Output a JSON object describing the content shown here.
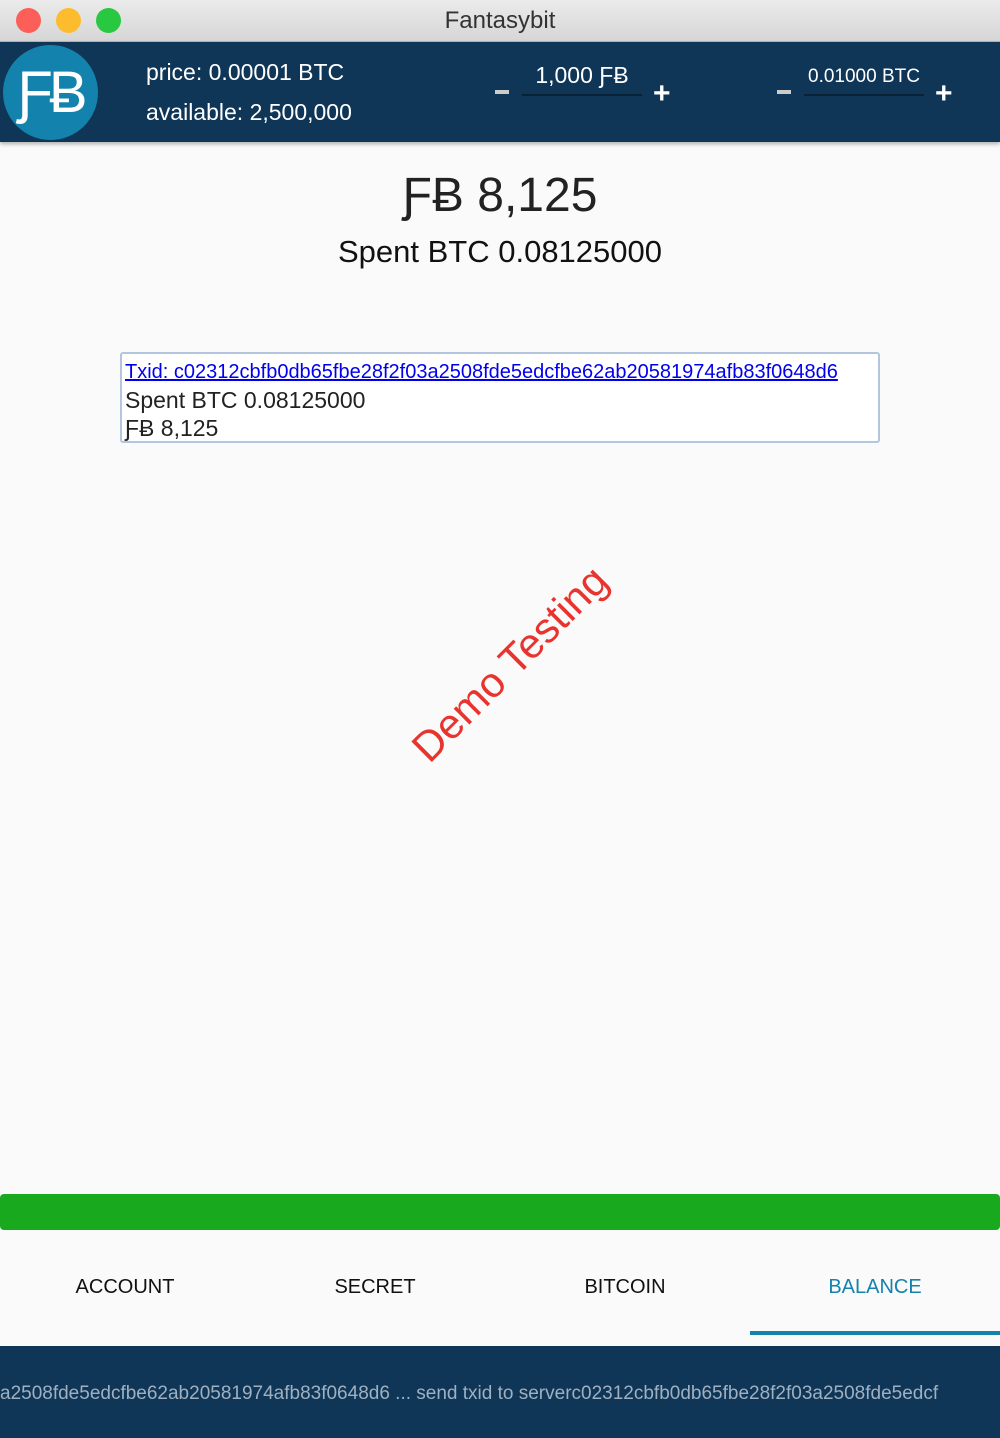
{
  "window": {
    "title": "Fantasybit"
  },
  "header": {
    "logo_text": "ƑɃ",
    "price": "price: 0.00001 BTC",
    "available": "available: 2,500,000",
    "fb_amount": "1,000 ƑɃ",
    "btc_amount": "0.01000 BTC"
  },
  "main": {
    "fb_total": "ƑɃ 8,125",
    "spent": "Spent BTC 0.08125000"
  },
  "receipt": {
    "txid": "Txid: c02312cbfb0db65fbe28f2f03a2508fde5edcfbe62ab20581974afb83f0648d6",
    "spent": "Spent BTC 0.08125000",
    "fb": "ƑɃ 8,125"
  },
  "watermark": "Demo Testing",
  "progress": {
    "percent": 100,
    "color": "#19a91f"
  },
  "tabs": [
    {
      "label": "ACCOUNT"
    },
    {
      "label": "SECRET"
    },
    {
      "label": "BITCOIN"
    },
    {
      "label": "BALANCE",
      "active": true
    }
  ],
  "status": "a2508fde5edcfbe62ab20581974afb83f0648d6  ... send txid to serverc02312cbfb0db65fbe28f2f03a2508fde5edcf"
}
